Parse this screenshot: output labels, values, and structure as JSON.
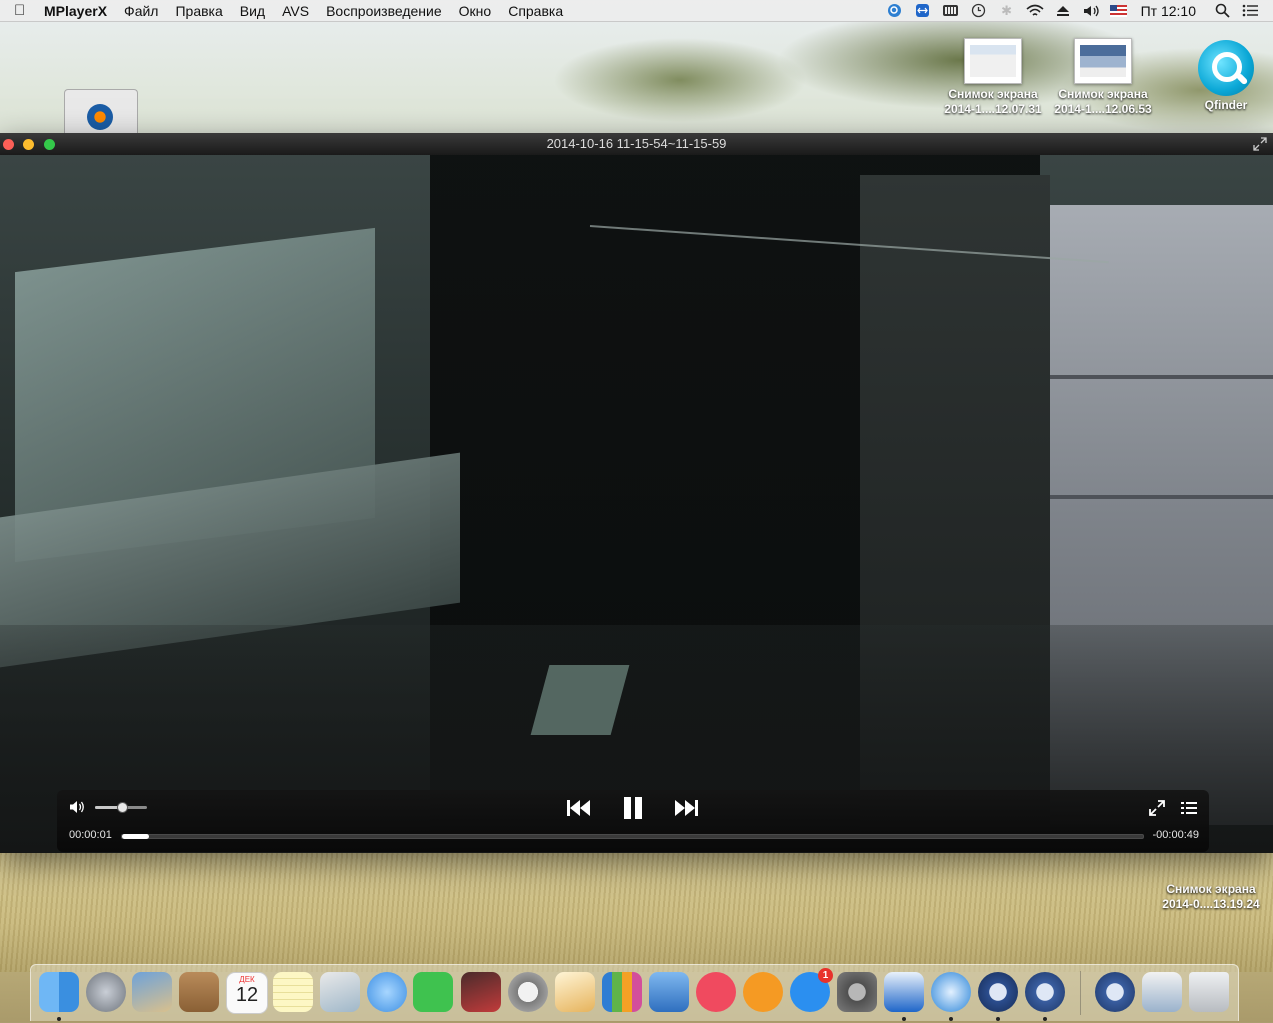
{
  "menubar": {
    "app_name": "MPlayerX",
    "items": [
      "Файл",
      "Правка",
      "Вид",
      "AVS",
      "Воспроизведение",
      "Окно",
      "Справка"
    ],
    "clock": "Пт 12:10"
  },
  "desktop": {
    "icons": [
      {
        "name_line1": "Снимок экрана",
        "name_line2": "2014-1....12.07.31"
      },
      {
        "name_line1": "Снимок экрана",
        "name_line2": "2014-1....12.06.53"
      },
      {
        "name_line1": "Qfinder",
        "name_line2": ""
      },
      {
        "name_line1": "Снимок экрана",
        "name_line2": "2014-0....13.19.24"
      }
    ]
  },
  "player": {
    "window_title": "2014-10-16 11-15-54~11-15-59",
    "time_elapsed": "00:00:01",
    "time_remaining": "-00:00:49",
    "volume_fraction": 0.5,
    "progress_fraction": 0.02
  },
  "dock": {
    "calendar_month": "ДЕК",
    "calendar_day": "12",
    "app_store_badge": "1",
    "colors": {
      "finder": "#3a8fe0",
      "launchpad": "#8a8e94",
      "itunes": "#f04a5f",
      "ibooks": "#f59a23",
      "appstore": "#2b8ff0",
      "facetime": "#3fc24f"
    }
  }
}
